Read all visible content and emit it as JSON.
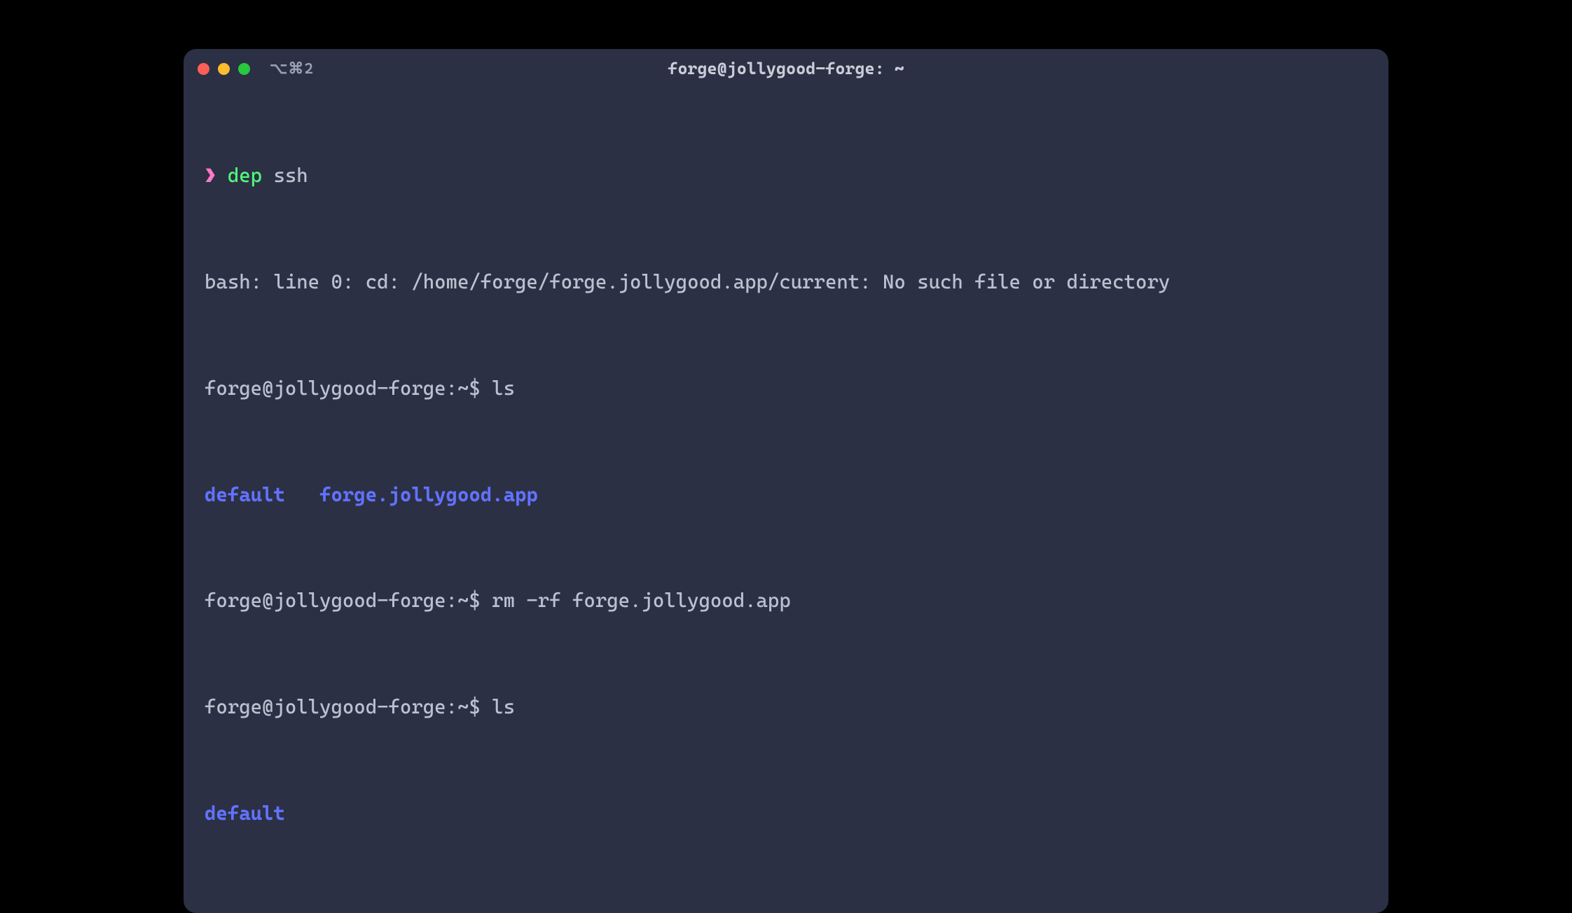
{
  "window": {
    "title": "forge@jollygood-forge: ~",
    "tab_indicator": "⌥⌘2"
  },
  "colors": {
    "bg": "#2b3044",
    "text": "#bcc1d0",
    "pink": "#ff79c6",
    "green": "#50fa7b",
    "blue": "#6272ff"
  },
  "lines": {
    "l1": {
      "chevron": "❯",
      "cmd": "dep",
      "arg": "ssh"
    },
    "l2": "bash: line 0: cd: /home/forge/forge.jollygood.app/current: No such file or directory",
    "l3": {
      "prompt": "forge@jollygood-forge:~$",
      "cmd": "ls"
    },
    "l4": {
      "dir1": "default",
      "dir2": "forge.jollygood.app"
    },
    "l5": {
      "prompt": "forge@jollygood-forge:~$",
      "cmd": "rm -rf forge.jollygood.app"
    },
    "l6": {
      "prompt": "forge@jollygood-forge:~$",
      "cmd": "ls"
    },
    "l7": {
      "dir1": "default"
    }
  }
}
